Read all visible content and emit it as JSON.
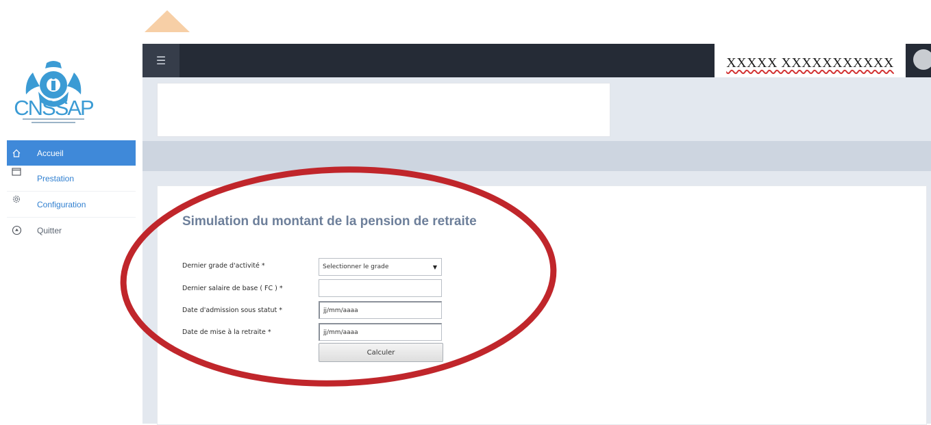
{
  "app": {
    "logo_text": "CNSSAP",
    "user_name": "XXXXX XXXXXXXXXXX"
  },
  "sidebar": {
    "items": [
      {
        "label": "Accueil",
        "icon": "home-icon",
        "active": true
      },
      {
        "label": "Prestation",
        "icon": "window-icon",
        "active": false
      },
      {
        "label": "Configuration",
        "icon": "gear-icon",
        "active": false
      },
      {
        "label": "Quitter",
        "icon": "exit-icon",
        "active": false
      }
    ]
  },
  "form": {
    "title": "Simulation du montant de la pension de retraite",
    "fields": [
      {
        "label": "Dernier grade d'activité *",
        "value": "Selectionner le grade",
        "type": "select"
      },
      {
        "label": "Dernier salaire de base ( FC ) *",
        "value": "",
        "type": "text"
      },
      {
        "label": "Date d'admission sous statut *",
        "value": "jj/mm/aaaa",
        "type": "date"
      },
      {
        "label": "Date de mise à la retraite *",
        "value": "jj/mm/aaaa",
        "type": "date"
      }
    ],
    "submit_label": "Calculer"
  },
  "colors": {
    "topbar": "#252b36",
    "accent": "#3f89d9",
    "annotation": "#c0262b",
    "triangle": "#f7cfa6"
  }
}
